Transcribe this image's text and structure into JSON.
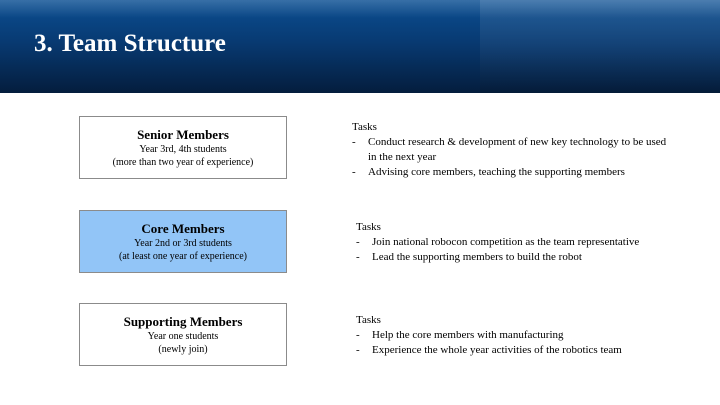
{
  "slide": {
    "title": "3. Team Structure"
  },
  "groups": [
    {
      "name": "Senior Members",
      "line1": "Year 3rd, 4th students",
      "line2": "(more than two year of experience)",
      "tasks_heading": "Tasks",
      "tasks": [
        "Conduct research & development of new key technology to be used in the next year",
        "Advising core members, teaching the supporting members"
      ]
    },
    {
      "name": "Core Members",
      "line1": "Year 2nd or 3rd students",
      "line2": "(at least one year of experience)",
      "tasks_heading": "Tasks",
      "tasks": [
        "Join national robocon competition as the team representative",
        "Lead the supporting members to build the robot"
      ]
    },
    {
      "name": "Supporting Members",
      "line1": "Year one students",
      "line2": "(newly join)",
      "tasks_heading": "Tasks",
      "tasks": [
        "Help the core members with manufacturing",
        "Experience the whole year activities of the robotics team"
      ]
    }
  ],
  "bullet_char": "-",
  "colors": {
    "header_top": "#0b4f93",
    "header_bottom": "#041d3d",
    "highlight_box": "#92c5f7",
    "box_border": "#8b8b8b"
  }
}
